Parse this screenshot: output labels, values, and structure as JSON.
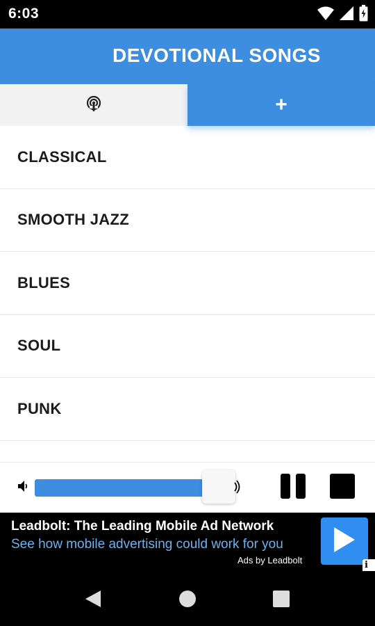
{
  "status_bar": {
    "time": "6:03"
  },
  "app_bar": {
    "title": "DEVOTIONAL SONGS"
  },
  "tabs": [
    {
      "name": "radio",
      "icon": "podcast-icon",
      "active": false
    },
    {
      "name": "add",
      "label": "+",
      "active": true
    }
  ],
  "genres": [
    "CLASSICAL",
    "SMOOTH JAZZ",
    "BLUES",
    "SOUL",
    "PUNK"
  ],
  "player": {
    "volume_fraction": 0.92
  },
  "ad": {
    "title": "Leadbolt: The Leading Mobile Ad Network",
    "subtitle": "See how mobile advertising could work for you",
    "attribution": "Ads by Leadbolt",
    "info_label": "i"
  },
  "colors": {
    "primary": "#3d8ee0",
    "ad_link": "#6bb2f0",
    "ad_button": "#2f8ef0"
  }
}
